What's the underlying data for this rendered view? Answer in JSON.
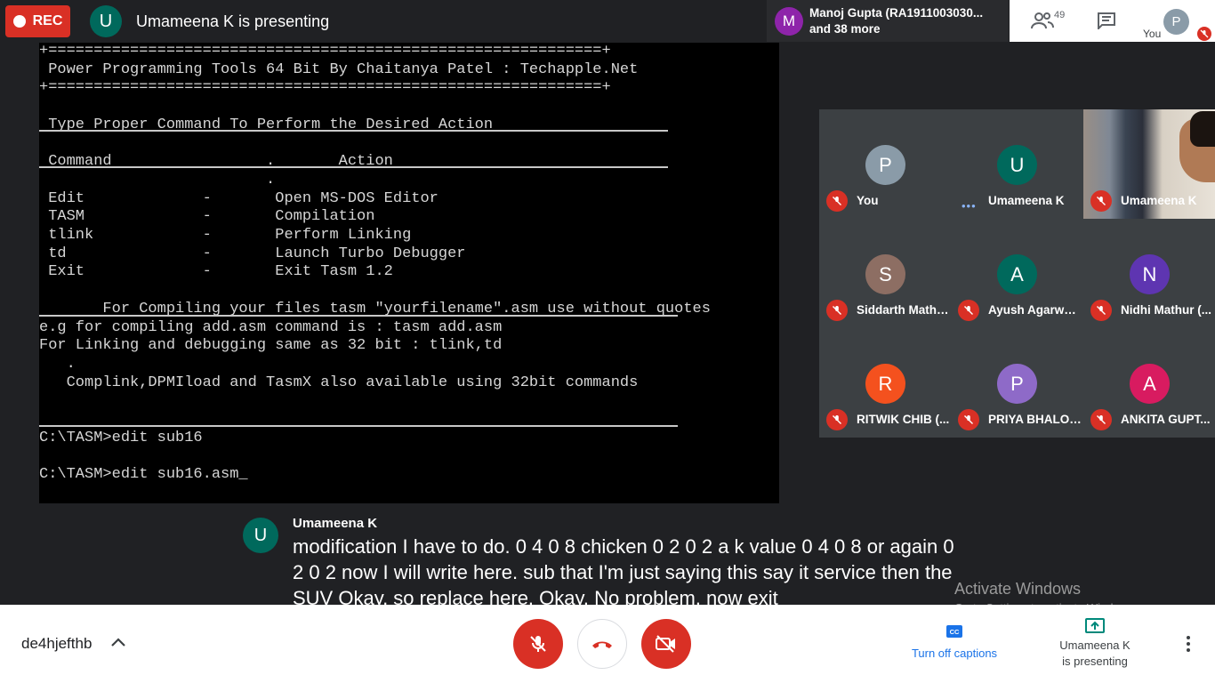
{
  "topbar": {
    "rec_label": "REC",
    "presenter_initial": "U",
    "presenter_text": "Umameena K is presenting"
  },
  "people_pill": {
    "initial": "M",
    "line1": "Manoj Gupta (RA1911003030...",
    "line2": "and 38 more"
  },
  "top_right": {
    "people_count": "49",
    "you_initial": "P",
    "you_label": "You"
  },
  "screen": {
    "border_top": "+=============================================================+",
    "title": " Power Programming Tools 64 Bit By Chaitanya Patel : Techapple.Net",
    "border_bottom": "+=============================================================+",
    "heading": " Type Proper Command To Perform the Desired Action",
    "col_header": " Command                 .       Action",
    "col_header_dot": "                         .",
    "rows": [
      " Edit             -       Open MS-DOS Editor",
      " TASM             -       Compilation",
      " tlink            -       Perform Linking",
      " td               -       Launch Turbo Debugger",
      " Exit             -       Exit Tasm 1.2"
    ],
    "note1": "       For Compiling your files tasm \"yourfilename\".asm use without quotes",
    "note2": "e.g for compiling add.asm command is : tasm add.asm",
    "note3": "For Linking and debugging same as 32 bit : tlink,td",
    "note4": "   .",
    "note5": "   Complink,DPMIload and TasmX also available using 32bit commands",
    "prompt1": "C:\\TASM>edit sub16",
    "prompt2": "C:\\TASM>edit sub16.asm_"
  },
  "participants": [
    {
      "initial": "P",
      "name": "You",
      "color": "#8a9ba8"
    },
    {
      "initial": "U",
      "name": "Umameena K",
      "color": "#00695c"
    },
    {
      "initial": "",
      "name": "Umameena K",
      "color": ""
    },
    {
      "initial": "S",
      "name": "Siddarth Mathu...",
      "color": "#8d6e63"
    },
    {
      "initial": "A",
      "name": "Ayush Agarwal...",
      "color": "#00695c"
    },
    {
      "initial": "N",
      "name": "Nidhi Mathur (...",
      "color": "#5e35b1"
    },
    {
      "initial": "R",
      "name": "RITWIK CHIB (...",
      "color": "#f4511e"
    },
    {
      "initial": "P",
      "name": "PRIYA BHALOT...",
      "color": "#8e6ac8"
    },
    {
      "initial": "A",
      "name": "ANKITA GUPT...",
      "color": "#d81b60"
    }
  ],
  "captions": {
    "initial": "U",
    "speaker": "Umameena K",
    "text": "modification I have to do. 0 4 0 8 chicken 0 2 0 2 a k value 0 4 0 8 or again 0 2 0 2 now I will write here. sub that I'm just saying this say it service then the SUV Okay, so replace here. Okay. No problem. now exit"
  },
  "watermark": {
    "title": "Activate Windows",
    "subtitle": "Go to Settings to activate Windows."
  },
  "bottom": {
    "meeting_code": "de4hjefthb",
    "captions_label": "Turn off captions",
    "presenting_line1": "Umameena K",
    "presenting_line2": "is presenting"
  }
}
